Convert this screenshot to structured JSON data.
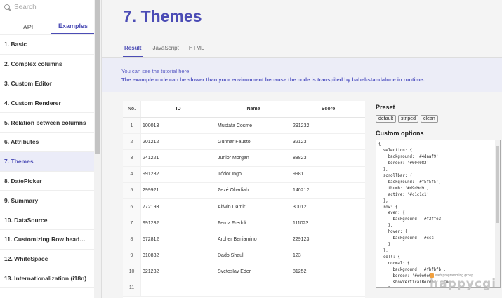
{
  "sidebar": {
    "search_placeholder": "Search",
    "tabs": [
      {
        "label": "API"
      },
      {
        "label": "Examples"
      }
    ],
    "items": [
      {
        "label": "1. Basic"
      },
      {
        "label": "2. Complex columns"
      },
      {
        "label": "3. Custom Editor"
      },
      {
        "label": "4. Custom Renderer"
      },
      {
        "label": "5. Relation between columns"
      },
      {
        "label": "6. Attributes"
      },
      {
        "label": "7. Themes"
      },
      {
        "label": "8. DatePicker"
      },
      {
        "label": "9. Summary"
      },
      {
        "label": "10. DataSource"
      },
      {
        "label": "11. Customizing Row head…"
      },
      {
        "label": "12. WhiteSpace"
      },
      {
        "label": "13. Internationalization (i18n)"
      }
    ]
  },
  "main": {
    "title": "7. Themes",
    "tabs": [
      {
        "label": "Result"
      },
      {
        "label": "JavaScript"
      },
      {
        "label": "HTML"
      }
    ],
    "notice": {
      "text_prefix": "You can see the tutorial ",
      "link": "here",
      "text_suffix": ".",
      "warning": "The example code can be slower than your environment because the code is transpiled by babel-standalone in runtime."
    }
  },
  "grid": {
    "headers": {
      "no": "No.",
      "id": "ID",
      "name": "Name",
      "score": "Score"
    },
    "rows": [
      {
        "no": "1",
        "id": "100013",
        "name": "Mustafa Cosme",
        "score": "291232"
      },
      {
        "no": "2",
        "id": "201212",
        "name": "Gunnar Fausto",
        "score": "32123"
      },
      {
        "no": "3",
        "id": "241221",
        "name": "Junior Morgan",
        "score": "88823"
      },
      {
        "no": "4",
        "id": "991232",
        "name": "Tódor Ingo",
        "score": "9981"
      },
      {
        "no": "5",
        "id": "299921",
        "name": "Zezé Obadiah",
        "score": "140212"
      },
      {
        "no": "6",
        "id": "772193",
        "name": "Alfwin Damir",
        "score": "30012"
      },
      {
        "no": "7",
        "id": "991232",
        "name": "Feroz Fredrik",
        "score": "111023"
      },
      {
        "no": "8",
        "id": "572812",
        "name": "Archer Beniamino",
        "score": "229123"
      },
      {
        "no": "9",
        "id": "310832",
        "name": "Dado Shaul",
        "score": "123"
      },
      {
        "no": "10",
        "id": "321232",
        "name": "Svetoslav Eder",
        "score": "81252"
      },
      {
        "no": "11",
        "id": "",
        "name": "",
        "score": ""
      }
    ]
  },
  "preset": {
    "title": "Preset",
    "buttons": [
      {
        "label": "default"
      },
      {
        "label": "striped"
      },
      {
        "label": "clean"
      }
    ]
  },
  "custom_options": {
    "title": "Custom options",
    "code": "{\n  selection: {\n    background: '#4daaf9',\n    border: '#004082'\n  },\n  scrollbar: {\n    background: '#f5f5f5',\n    thumb: '#d9d9d9',\n    active: '#c1c1c1'\n  },\n  row: {\n    even: {\n      background: '#f3ffe3'\n    },\n    hover: {\n      background: '#ccc'\n    }\n  },\n  cell: {\n    normal: {\n      background: '#fbfbfb',\n      border: '#e0e0e0',\n      showVerticalBorder: true\n    },\n    header: {\n      background: '#eee',"
  },
  "watermark": {
    "sub": "web programming group",
    "main": "happycgi"
  },
  "colors": {
    "accent": "#4b4cb5",
    "notice_bg": "#ecedf7",
    "main_bg": "#f4f4f4"
  }
}
